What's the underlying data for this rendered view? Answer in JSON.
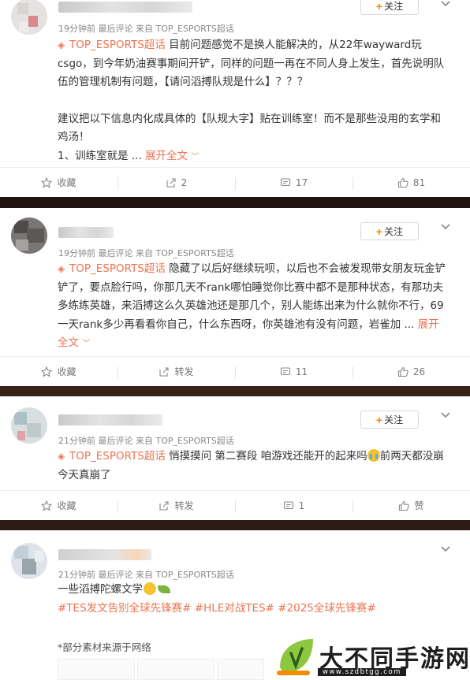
{
  "posts": [
    {
      "meta": "19分钟前  最后评论  来自 TOP_ESPORTS超话",
      "topic": "TOP_ESPORTS超话",
      "text": " 目前问题感觉不是换人能解决的，从22年wayward玩csgo，到今年奶油赛事期间开铲，同样的问题一再在不同人身上发生，首先说明队伍的管理机制有问题，【请问滔搏队规是什么】？？？",
      "text2": "建议把以下信息内化成具体的【队规大字】贴在训练室！而不是那些没用的玄学和鸡汤！",
      "text3": "1、训练室就是 ... ",
      "expand": "展开全文",
      "follow": "关注",
      "actions": {
        "fav": "收藏",
        "share": "2",
        "comment": "17",
        "like": "81"
      }
    },
    {
      "meta": "19分钟前  最后评论  来自 TOP_ESPORTS超话",
      "topic": "TOP_ESPORTS超话",
      "text": " 隐藏了以后好继续玩呗，以后也不会被发现带女朋友玩金铲铲了，要点脸行吗，你那几天不rank哪怕睡觉你比赛中都不是那种状态，有那功夫多练练英雄，来滔搏这么久英雄池还是那几个，别人能练出来为什么就你不行，69一天rank多少再看看你自己，什么东西呀，你英雄池有没有问题，岩雀加 ... ",
      "expand": "展开全文",
      "follow": "关注",
      "actions": {
        "fav": "收藏",
        "share": "转发",
        "comment": "11",
        "like": "26"
      }
    },
    {
      "meta": "21分钟前  最后评论  来自 TOP_ESPORTS超话",
      "topic": "TOP_ESPORTS超话",
      "text": " 悄摸摸问 第二赛段 咱游戏还能开的起来吗",
      "text_after": "前两天都没崩 今天真崩了",
      "follow": "关注",
      "actions": {
        "fav": "收藏",
        "share": "转发",
        "comment": "1",
        "like": "赞"
      }
    },
    {
      "meta": "21分钟前  最后评论  来自 TOP_ESPORTS超话",
      "text": "一些滔搏陀螺文学",
      "tags": "#TES发文告别全球先锋赛# #HLE对战TES# #2025全球先锋赛#",
      "footnote": "*部分素材来源于网络"
    }
  ],
  "watermark": {
    "name": "大不同手游网",
    "url": "www.szdbtgg.com"
  },
  "colors": {
    "accent": "#eb7350",
    "follow_plus": "#ff8200",
    "background": "#2a1a14"
  },
  "icons": [
    "star-icon",
    "share-icon",
    "comment-icon",
    "like-icon",
    "chevron-down-icon",
    "topic-diamond-icon",
    "crying-emoji-icon",
    "sad-emoji-icon",
    "leaf-emoji-icon"
  ]
}
